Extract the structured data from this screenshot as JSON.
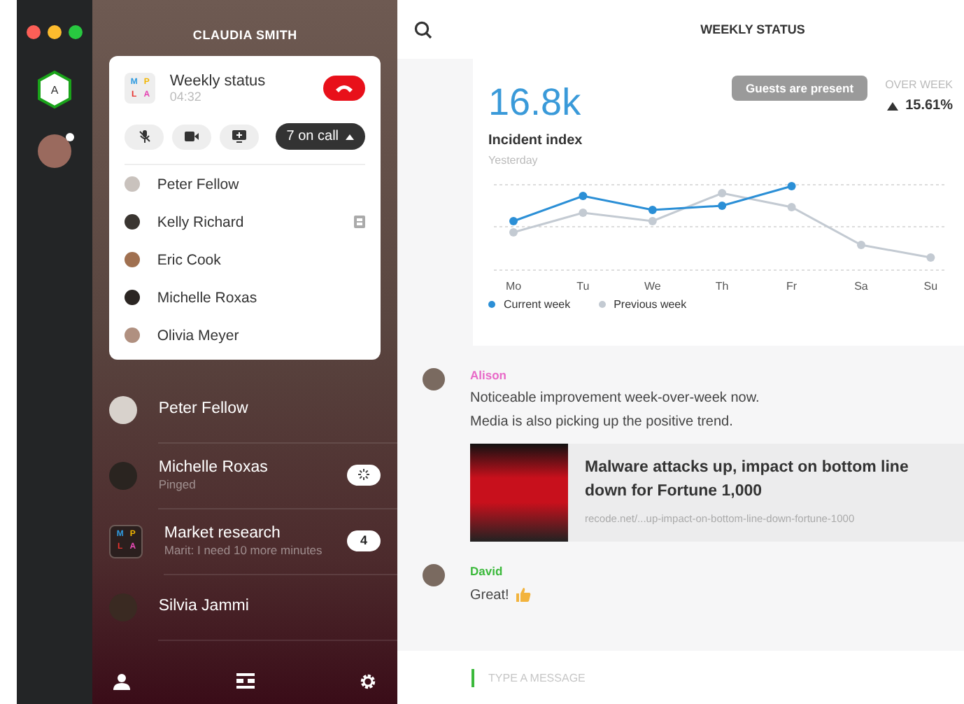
{
  "window": {
    "title": "CLAUDIA SMITH"
  },
  "rail": {
    "workspace": "A",
    "presence": true
  },
  "call_card": {
    "title": "Weekly status",
    "duration": "04:32",
    "on_call": "7 on call",
    "tiles": [
      {
        "letter": "M",
        "color": "#2f9be0"
      },
      {
        "letter": "P",
        "color": "#f2b600"
      },
      {
        "letter": "L",
        "color": "#e8322e"
      },
      {
        "letter": "A",
        "color": "#e64bb5"
      }
    ],
    "participants": [
      {
        "name": "Peter Fellow",
        "badge": false
      },
      {
        "name": "Kelly Richard",
        "badge": true
      },
      {
        "name": "Eric Cook",
        "badge": false
      },
      {
        "name": "Michelle Roxas",
        "badge": false
      },
      {
        "name": "Olivia Meyer",
        "badge": false
      }
    ]
  },
  "chats": [
    {
      "kind": "person",
      "name": "Peter Fellow"
    },
    {
      "kind": "person",
      "name": "Michelle Roxas",
      "subtitle": "Pinged",
      "badge": {
        "kind": "loading"
      }
    },
    {
      "kind": "group",
      "name": "Market research",
      "tiles": [
        {
          "letter": "M",
          "color": "#2f9be0"
        },
        {
          "letter": "P",
          "color": "#f2b600"
        },
        {
          "letter": "L",
          "color": "#e8322e"
        },
        {
          "letter": "A",
          "color": "#e64bb5"
        }
      ],
      "subtitle": "Marit: I need 10 more minutes",
      "badge": {
        "kind": "count",
        "text": "4"
      }
    },
    {
      "kind": "person",
      "name": "Silvia Jammi"
    }
  ],
  "main": {
    "title": "WEEKLY STATUS"
  },
  "stats": {
    "value": "16.8k",
    "label": "Incident index",
    "sublabel": "Yesterday",
    "compare_label": "OVER WEEK",
    "change": "15.61%",
    "tooltip": "Guests are present",
    "days": [
      "Mo",
      "Tu",
      "We",
      "Th",
      "Fr",
      "Sa",
      "Su"
    ],
    "legend": [
      {
        "name": "Current week",
        "color": "#2b8fd6"
      },
      {
        "name": "Previous week",
        "color": "#c3cad2"
      }
    ]
  },
  "messages": [
    {
      "kind": "link",
      "author": "Alison",
      "color": "#e86ac8",
      "lines": [
        "Noticeable improvement week-over-week now.",
        "Media is also picking up the positive trend."
      ],
      "link": {
        "title": "Malware attacks up, impact on bottom line down for Fortune 1,000",
        "url": "recode.net/...up-impact-on-bottom-line-down-fortune-1000"
      }
    },
    {
      "kind": "reaction",
      "author": "David",
      "color": "#3cb93c",
      "lines": [
        "Great!"
      ]
    }
  ],
  "composer": {
    "placeholder": "TYPE A MESSAGE"
  }
}
